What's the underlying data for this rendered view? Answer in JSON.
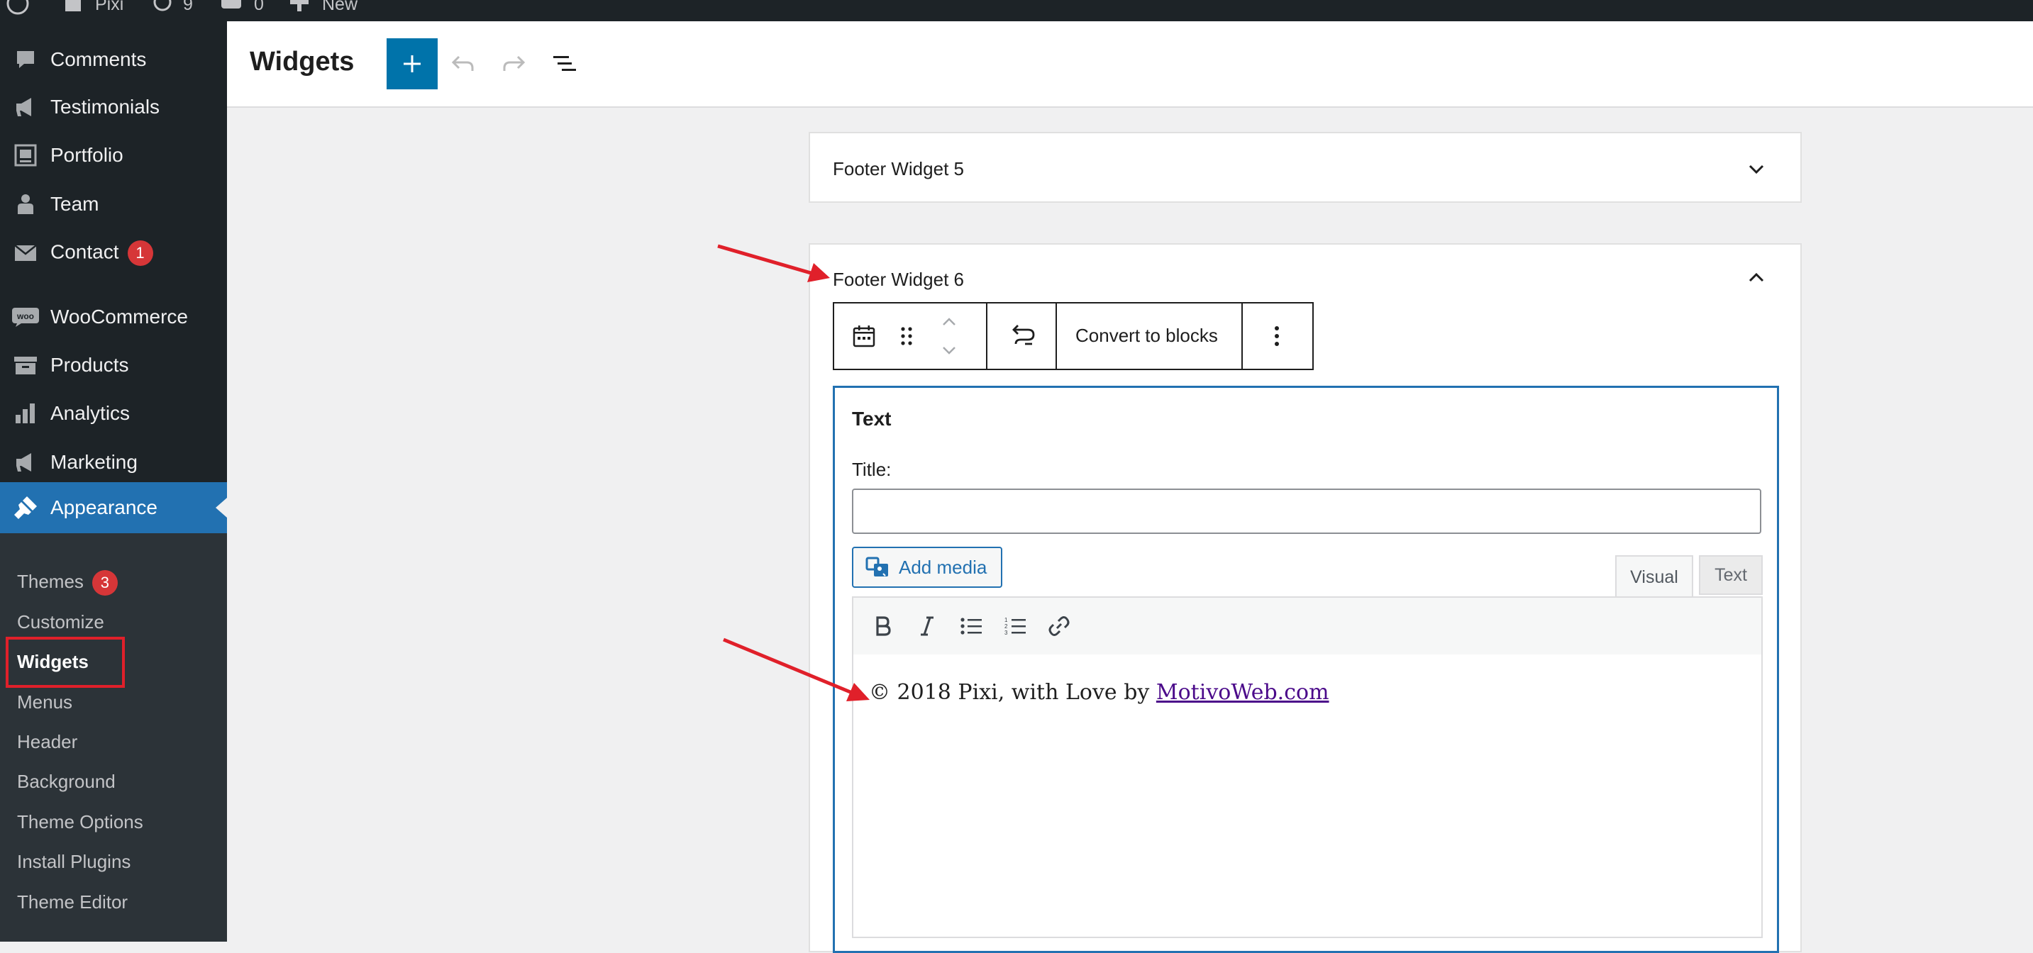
{
  "adminbar": {
    "site_name": "Pixi",
    "updates_count": "9",
    "comments_count": "0",
    "new_label": "New"
  },
  "sidebar": {
    "items": [
      {
        "label": "Comments",
        "icon": "comment-icon"
      },
      {
        "label": "Testimonials",
        "icon": "megaphone-icon"
      },
      {
        "label": "Portfolio",
        "icon": "portfolio-icon"
      },
      {
        "label": "Team",
        "icon": "person-icon"
      },
      {
        "label": "Contact",
        "icon": "envelope-icon",
        "badge": "1"
      },
      {
        "label": "WooCommerce",
        "icon": "woo-icon"
      },
      {
        "label": "Products",
        "icon": "archive-icon"
      },
      {
        "label": "Analytics",
        "icon": "bar-chart-icon"
      },
      {
        "label": "Marketing",
        "icon": "megaphone-icon"
      }
    ],
    "active": {
      "label": "Appearance",
      "icon": "paintbrush-icon"
    },
    "submenu": [
      {
        "label": "Themes",
        "badge": "3"
      },
      {
        "label": "Customize"
      },
      {
        "label": "Widgets",
        "current": true
      },
      {
        "label": "Menus"
      },
      {
        "label": "Header"
      },
      {
        "label": "Background"
      },
      {
        "label": "Theme Options"
      },
      {
        "label": "Install Plugins"
      },
      {
        "label": "Theme Editor"
      }
    ]
  },
  "header": {
    "title": "Widgets"
  },
  "widget_areas": [
    {
      "title": "Footer Widget 5",
      "expanded": false
    },
    {
      "title": "Footer Widget 6",
      "expanded": true
    }
  ],
  "block_toolbar": {
    "convert_label": "Convert to blocks"
  },
  "text_widget": {
    "heading": "Text",
    "title_label": "Title:",
    "title_value": "",
    "add_media_label": "Add media",
    "tab_visual": "Visual",
    "tab_text": "Text",
    "content_prefix": "© 2018 Pixi, with Love by ",
    "content_link": "MotivoWeb.com"
  },
  "colors": {
    "sidebar_bg": "#1d2327",
    "accent": "#2271b1",
    "add_button": "#0073aa",
    "badge": "#d63638",
    "annotation": "#e0202a"
  }
}
